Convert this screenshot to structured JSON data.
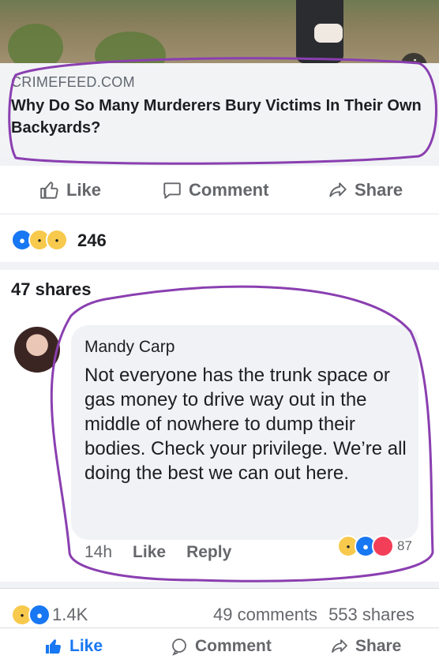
{
  "post": {
    "link_domain": "CRIMEFEED.COM",
    "link_headline": "Why Do So Many Murderers Bury Victims In Their Own Backyards?",
    "actions": {
      "like": "Like",
      "comment": "Comment",
      "share": "Share"
    },
    "reaction_count": "246",
    "shares_count": "47 shares"
  },
  "comment": {
    "author": "Mandy Carp",
    "text": "Not everyone has the trunk space or gas money to drive way out in the middle of nowhere to dump their bodies. Check your privilege. We’re all doing the best we can out here.",
    "time": "14h",
    "like_label": "Like",
    "reply_label": "Reply",
    "reaction_count": "87"
  },
  "outer_post": {
    "reaction_count": "1.4K",
    "comments_count": "49 comments",
    "shares_count": "553 shares",
    "actions": {
      "like": "Like",
      "comment": "Comment",
      "share": "Share"
    }
  },
  "colors": {
    "facebook_blue": "#1877f2",
    "annotation_purple": "#8a3fb0"
  }
}
